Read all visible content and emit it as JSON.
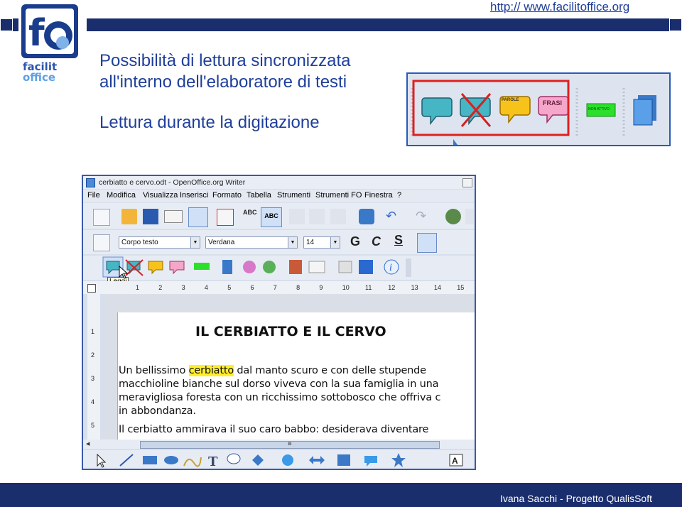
{
  "header": {
    "url": "http:// www.facilitoffice.org",
    "title_line1": "Possibilità di lettura sincronizzata",
    "title_line2": "all'interno dell'elaboratore di testi",
    "subtitle": "Lettura durante la digitazione",
    "logo_text": "facilit office"
  },
  "footer": {
    "text": "Ivana Sacchi - Progetto QualisSoft"
  },
  "zoom_toolbar": {
    "balloon1_label": "PAROLE",
    "balloon2_label": "FRASI",
    "green_label": "NON ATTIVO"
  },
  "window": {
    "title": "cerbiatto e cervo.odt - OpenOffice.org Writer",
    "menu": [
      "File",
      "Modifica",
      "Visualizza",
      "Inserisci",
      "Formato",
      "Tabella",
      "Strumenti",
      "Strumenti FO",
      "Finestra",
      "?"
    ],
    "paragraph_style": "Corpo testo",
    "font_name": "Verdana",
    "font_size": "14",
    "bold_label": "G",
    "italic_label": "C",
    "underline_label": "S",
    "tooltip": "Leggi",
    "ruler": [
      "1",
      "2",
      "3",
      "4",
      "5",
      "6",
      "7",
      "8",
      "9",
      "10",
      "11",
      "12",
      "13",
      "14",
      "15"
    ],
    "vruler": [
      "1",
      "2",
      "3",
      "4",
      "5"
    ],
    "doc_title": "IL CERBIATTO E IL CERVO",
    "doc_line1_pre": "Un bellissimo ",
    "doc_line1_hl": "cerbiatto",
    "doc_line1_post": " dal manto scuro e con delle stupende",
    "doc_line2": "macchioline bianche sul dorso viveva con la sua famiglia in una",
    "doc_line3": "meravigliosa foresta con un ricchissimo sottobosco che offriva c",
    "doc_line4": "in abbondanza.",
    "doc_line5": "Il cerbiatto ammirava il suo caro babbo: desiderava diventare",
    "scroll_mark": "III"
  },
  "colors": {
    "navy": "#1a2e6e",
    "title_blue": "#1f3f9a",
    "highlight": "#ffef2a",
    "red_frame": "#e02020"
  }
}
